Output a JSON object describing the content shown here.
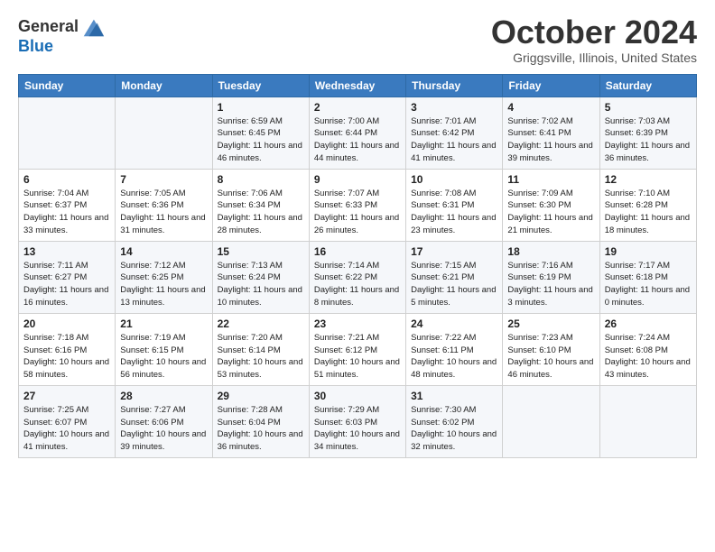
{
  "header": {
    "logo_line1": "General",
    "logo_line2": "Blue",
    "month_title": "October 2024",
    "location": "Griggsville, Illinois, United States"
  },
  "weekdays": [
    "Sunday",
    "Monday",
    "Tuesday",
    "Wednesday",
    "Thursday",
    "Friday",
    "Saturday"
  ],
  "weeks": [
    [
      {
        "day": "",
        "sunrise": "",
        "sunset": "",
        "daylight": ""
      },
      {
        "day": "",
        "sunrise": "",
        "sunset": "",
        "daylight": ""
      },
      {
        "day": "1",
        "sunrise": "Sunrise: 6:59 AM",
        "sunset": "Sunset: 6:45 PM",
        "daylight": "Daylight: 11 hours and 46 minutes."
      },
      {
        "day": "2",
        "sunrise": "Sunrise: 7:00 AM",
        "sunset": "Sunset: 6:44 PM",
        "daylight": "Daylight: 11 hours and 44 minutes."
      },
      {
        "day": "3",
        "sunrise": "Sunrise: 7:01 AM",
        "sunset": "Sunset: 6:42 PM",
        "daylight": "Daylight: 11 hours and 41 minutes."
      },
      {
        "day": "4",
        "sunrise": "Sunrise: 7:02 AM",
        "sunset": "Sunset: 6:41 PM",
        "daylight": "Daylight: 11 hours and 39 minutes."
      },
      {
        "day": "5",
        "sunrise": "Sunrise: 7:03 AM",
        "sunset": "Sunset: 6:39 PM",
        "daylight": "Daylight: 11 hours and 36 minutes."
      }
    ],
    [
      {
        "day": "6",
        "sunrise": "Sunrise: 7:04 AM",
        "sunset": "Sunset: 6:37 PM",
        "daylight": "Daylight: 11 hours and 33 minutes."
      },
      {
        "day": "7",
        "sunrise": "Sunrise: 7:05 AM",
        "sunset": "Sunset: 6:36 PM",
        "daylight": "Daylight: 11 hours and 31 minutes."
      },
      {
        "day": "8",
        "sunrise": "Sunrise: 7:06 AM",
        "sunset": "Sunset: 6:34 PM",
        "daylight": "Daylight: 11 hours and 28 minutes."
      },
      {
        "day": "9",
        "sunrise": "Sunrise: 7:07 AM",
        "sunset": "Sunset: 6:33 PM",
        "daylight": "Daylight: 11 hours and 26 minutes."
      },
      {
        "day": "10",
        "sunrise": "Sunrise: 7:08 AM",
        "sunset": "Sunset: 6:31 PM",
        "daylight": "Daylight: 11 hours and 23 minutes."
      },
      {
        "day": "11",
        "sunrise": "Sunrise: 7:09 AM",
        "sunset": "Sunset: 6:30 PM",
        "daylight": "Daylight: 11 hours and 21 minutes."
      },
      {
        "day": "12",
        "sunrise": "Sunrise: 7:10 AM",
        "sunset": "Sunset: 6:28 PM",
        "daylight": "Daylight: 11 hours and 18 minutes."
      }
    ],
    [
      {
        "day": "13",
        "sunrise": "Sunrise: 7:11 AM",
        "sunset": "Sunset: 6:27 PM",
        "daylight": "Daylight: 11 hours and 16 minutes."
      },
      {
        "day": "14",
        "sunrise": "Sunrise: 7:12 AM",
        "sunset": "Sunset: 6:25 PM",
        "daylight": "Daylight: 11 hours and 13 minutes."
      },
      {
        "day": "15",
        "sunrise": "Sunrise: 7:13 AM",
        "sunset": "Sunset: 6:24 PM",
        "daylight": "Daylight: 11 hours and 10 minutes."
      },
      {
        "day": "16",
        "sunrise": "Sunrise: 7:14 AM",
        "sunset": "Sunset: 6:22 PM",
        "daylight": "Daylight: 11 hours and 8 minutes."
      },
      {
        "day": "17",
        "sunrise": "Sunrise: 7:15 AM",
        "sunset": "Sunset: 6:21 PM",
        "daylight": "Daylight: 11 hours and 5 minutes."
      },
      {
        "day": "18",
        "sunrise": "Sunrise: 7:16 AM",
        "sunset": "Sunset: 6:19 PM",
        "daylight": "Daylight: 11 hours and 3 minutes."
      },
      {
        "day": "19",
        "sunrise": "Sunrise: 7:17 AM",
        "sunset": "Sunset: 6:18 PM",
        "daylight": "Daylight: 11 hours and 0 minutes."
      }
    ],
    [
      {
        "day": "20",
        "sunrise": "Sunrise: 7:18 AM",
        "sunset": "Sunset: 6:16 PM",
        "daylight": "Daylight: 10 hours and 58 minutes."
      },
      {
        "day": "21",
        "sunrise": "Sunrise: 7:19 AM",
        "sunset": "Sunset: 6:15 PM",
        "daylight": "Daylight: 10 hours and 56 minutes."
      },
      {
        "day": "22",
        "sunrise": "Sunrise: 7:20 AM",
        "sunset": "Sunset: 6:14 PM",
        "daylight": "Daylight: 10 hours and 53 minutes."
      },
      {
        "day": "23",
        "sunrise": "Sunrise: 7:21 AM",
        "sunset": "Sunset: 6:12 PM",
        "daylight": "Daylight: 10 hours and 51 minutes."
      },
      {
        "day": "24",
        "sunrise": "Sunrise: 7:22 AM",
        "sunset": "Sunset: 6:11 PM",
        "daylight": "Daylight: 10 hours and 48 minutes."
      },
      {
        "day": "25",
        "sunrise": "Sunrise: 7:23 AM",
        "sunset": "Sunset: 6:10 PM",
        "daylight": "Daylight: 10 hours and 46 minutes."
      },
      {
        "day": "26",
        "sunrise": "Sunrise: 7:24 AM",
        "sunset": "Sunset: 6:08 PM",
        "daylight": "Daylight: 10 hours and 43 minutes."
      }
    ],
    [
      {
        "day": "27",
        "sunrise": "Sunrise: 7:25 AM",
        "sunset": "Sunset: 6:07 PM",
        "daylight": "Daylight: 10 hours and 41 minutes."
      },
      {
        "day": "28",
        "sunrise": "Sunrise: 7:27 AM",
        "sunset": "Sunset: 6:06 PM",
        "daylight": "Daylight: 10 hours and 39 minutes."
      },
      {
        "day": "29",
        "sunrise": "Sunrise: 7:28 AM",
        "sunset": "Sunset: 6:04 PM",
        "daylight": "Daylight: 10 hours and 36 minutes."
      },
      {
        "day": "30",
        "sunrise": "Sunrise: 7:29 AM",
        "sunset": "Sunset: 6:03 PM",
        "daylight": "Daylight: 10 hours and 34 minutes."
      },
      {
        "day": "31",
        "sunrise": "Sunrise: 7:30 AM",
        "sunset": "Sunset: 6:02 PM",
        "daylight": "Daylight: 10 hours and 32 minutes."
      },
      {
        "day": "",
        "sunrise": "",
        "sunset": "",
        "daylight": ""
      },
      {
        "day": "",
        "sunrise": "",
        "sunset": "",
        "daylight": ""
      }
    ]
  ]
}
